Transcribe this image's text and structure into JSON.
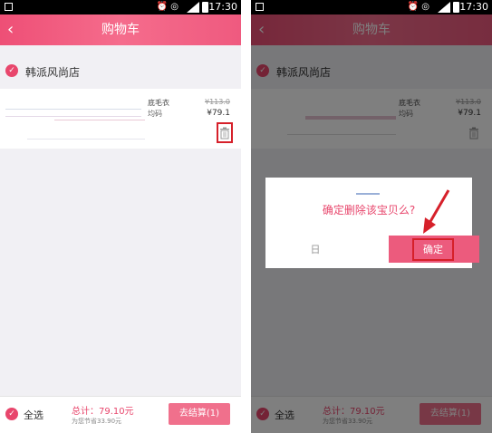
{
  "status_bar": {
    "network": "3G",
    "time": "17:30"
  },
  "header": {
    "back_icon": "back-arrow-icon",
    "title": "购物车"
  },
  "shop": {
    "name": "韩派风尚店"
  },
  "item": {
    "title_fragment": "底毛衣",
    "spec_fragment": "均码",
    "original_price": "¥113.0",
    "price": "¥79.1"
  },
  "bottom_bar": {
    "select_all_label": "全选",
    "total": "总计：79.10元",
    "saved": "为您节省33.90元",
    "checkout_label": "去结算(1)"
  },
  "dialog": {
    "message": "确定删除该宝贝么?",
    "cancel_partial": "日",
    "confirm_label": "确定"
  },
  "colors": {
    "accent": "#e8466c",
    "header": "#f0628a",
    "highlight_box": "#d6202a"
  }
}
